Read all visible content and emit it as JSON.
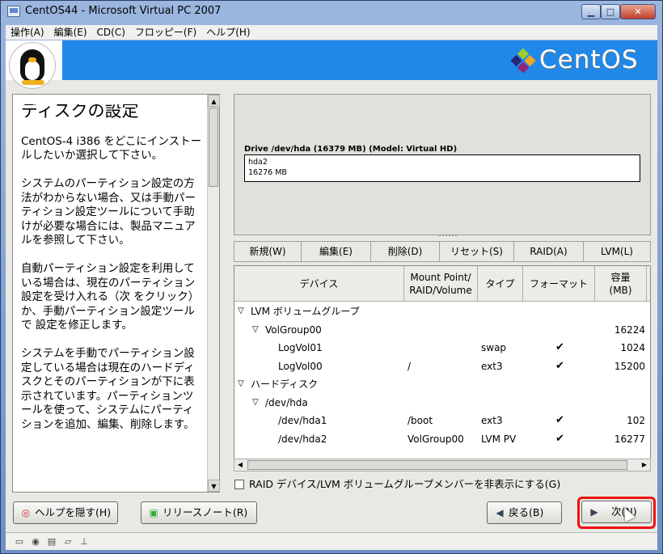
{
  "window": {
    "title": "CentOS44 - Microsoft Virtual PC 2007",
    "minimize_icon": "minimize-icon",
    "maximize_icon": "maximize-icon",
    "close_icon": "close-icon"
  },
  "menu": [
    {
      "label": "操作(A)"
    },
    {
      "label": "編集(E)"
    },
    {
      "label": "CD(C)"
    },
    {
      "label": "フロッピー(F)"
    },
    {
      "label": "ヘルプ(H)"
    }
  ],
  "banner": {
    "logo_text": "CentOS",
    "background": "#1f88e8"
  },
  "help": {
    "title": "ディスクの設定",
    "paragraphs": [
      "CentOS-4 i386 をどこにインストールしたいか選択して下さい。",
      "システムのパーティション設定の方法がわからない場合、又は手動パーティション設定ツールについて手助けが必要な場合には、製品マニュアルを参照して下さい。",
      "自動パーティション設定を利用している場合は、現在のパーティション設定を受け入れる（次 をクリック）か、手動パーティション設定ツールで  設定を修正します。",
      "システムを手動でパーティション設定している場合は現在のハードディスクとそのパーティションが下に表示されています。パーティションツールを使って、システムにパーティションを追加、編集、削除します。"
    ]
  },
  "drive": {
    "label": "Drive /dev/hda (16379 MB) (Model: Virtual HD)",
    "partition_name": "hda2",
    "partition_size": "16276 MB"
  },
  "toolbar": {
    "new": "新規(W)",
    "edit": "編集(E)",
    "delete": "削除(D)",
    "reset": "リセット(S)",
    "raid": "RAID(A)",
    "lvm": "LVM(L)"
  },
  "table": {
    "columns": {
      "device": "デバイス",
      "mount": "Mount Point/\nRAID/Volume",
      "type": "タイプ",
      "format": "フォーマット",
      "size": "容量\n(MB)"
    },
    "rows": [
      {
        "device": "LVM ボリュームグループ",
        "mount": "",
        "type": "",
        "format": false,
        "size": "",
        "level": 0,
        "expander": true
      },
      {
        "device": "VolGroup00",
        "mount": "",
        "type": "",
        "format": false,
        "size": "16224",
        "level": 1,
        "expander": true
      },
      {
        "device": "LogVol01",
        "mount": "",
        "type": "swap",
        "format": true,
        "size": "1024",
        "level": 2,
        "expander": false
      },
      {
        "device": "LogVol00",
        "mount": "/",
        "type": "ext3",
        "format": true,
        "size": "15200",
        "level": 2,
        "expander": false
      },
      {
        "device": "ハードディスク",
        "mount": "",
        "type": "",
        "format": false,
        "size": "",
        "level": 0,
        "expander": true
      },
      {
        "device": "/dev/hda",
        "mount": "",
        "type": "",
        "format": false,
        "size": "",
        "level": 1,
        "expander": true
      },
      {
        "device": "/dev/hda1",
        "mount": "/boot",
        "type": "ext3",
        "format": true,
        "size": "102",
        "level": 2,
        "expander": false
      },
      {
        "device": "/dev/hda2",
        "mount": "VolGroup00",
        "type": "LVM PV",
        "format": true,
        "size": "16277",
        "level": 2,
        "expander": false
      }
    ],
    "check_glyph": "✔",
    "expander_glyph": "▽"
  },
  "hide_option": {
    "label": "RAID デバイス/LVM ボリュームグループメンバーを非表示にする(G)",
    "checked": false
  },
  "buttons": {
    "hide_help": "ヘルプを隠す(H)",
    "release_notes": "リリースノート(R)",
    "back": "戻る(B)",
    "next": "次(N)"
  },
  "colors": {
    "highlight": "#e11111",
    "banner_blue": "#1f88e8"
  }
}
